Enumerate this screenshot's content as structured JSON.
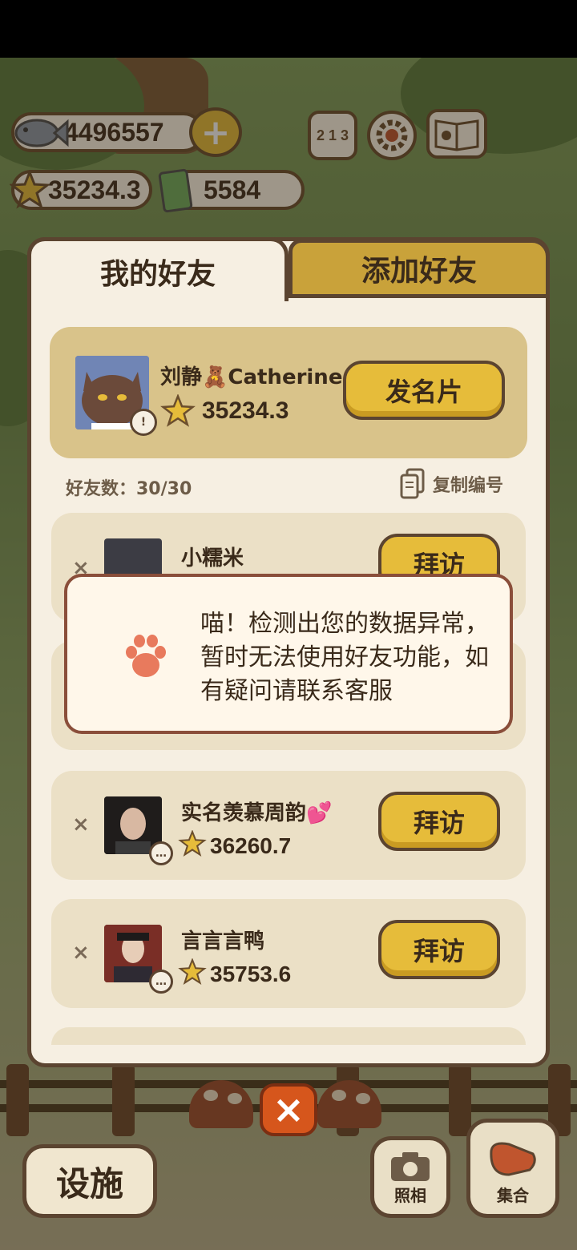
{
  "hud": {
    "fish": "4496557",
    "stars": "35234.3",
    "tickets": "5584",
    "rank_label": "2 1 3"
  },
  "tabs": {
    "my_friends": "我的好友",
    "add_friend": "添加好友"
  },
  "me": {
    "name": "刘静🧸Catherine",
    "score": "35234.3",
    "card_button": "发名片"
  },
  "friend_count": "好友数：30/30",
  "copy_id": "复制编号",
  "friends": [
    {
      "name": "小糯米",
      "score": "",
      "button": "拜访"
    },
    {
      "name": "实名羡慕周韵💕",
      "score": "36260.7",
      "button": "拜访"
    },
    {
      "name": "言言言鸭",
      "score": "35753.6",
      "button": "拜访"
    }
  ],
  "toast": {
    "text": "喵！检测出您的数据异常，暂时无法使用好友功能，如有疑问请联系客服"
  },
  "bottom": {
    "facilities": "设施",
    "camera": "照相",
    "gather": "集合"
  },
  "colors": {
    "gold": "#e6bc3a",
    "panel": "#f6efe2",
    "border": "#5b4430",
    "close": "#d6561c",
    "paw": "#e87a5d"
  },
  "icons": [
    "fish-icon",
    "plus-icon",
    "star-icon",
    "ticket-icon",
    "rank-icon",
    "settings-icon",
    "book-icon",
    "paw-icon",
    "copy-icon",
    "close-icon",
    "camera-icon",
    "whistle-icon"
  ]
}
